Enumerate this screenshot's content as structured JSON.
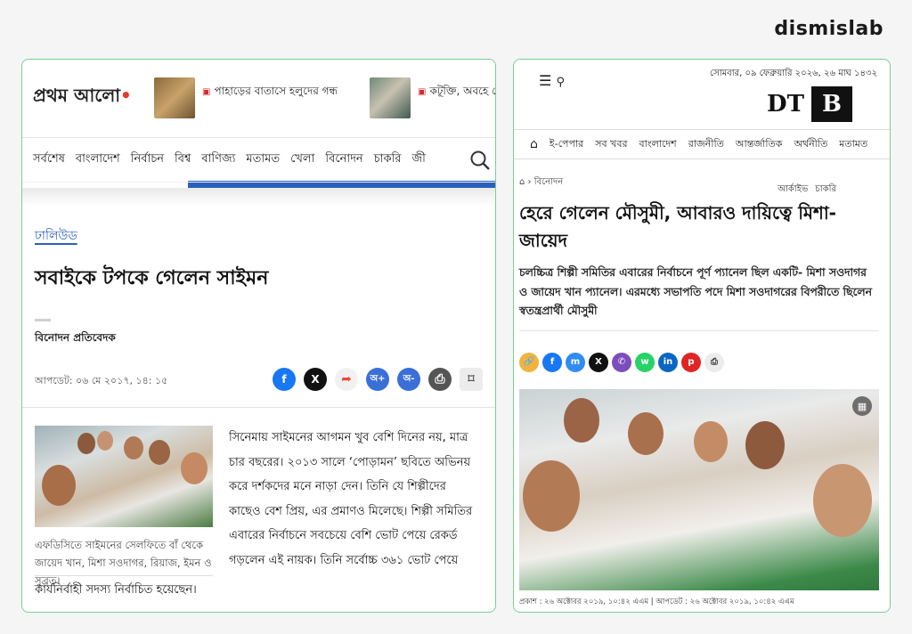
{
  "brand": "dismislab",
  "left": {
    "logo": "প্রথম আলো",
    "headlines": [
      "পাহাড়ের বাতাসে হলুদের গন্ধ",
      "কটূক্তি, অবহে পেরিয়ে যেভাবে সম"
    ],
    "nav": [
      "সর্বশেষ",
      "বাংলাদেশ",
      "নির্বাচন",
      "বিশ্ব",
      "বাণিজ্য",
      "মতামত",
      "খেলা",
      "বিনোদন",
      "চাকরি",
      "জী"
    ],
    "category": "ঢালিউড",
    "title": "সবাইকে টপকে গেলেন সাইমন",
    "author": "বিনোদন প্রতিবেদক",
    "date": "আপডেট: ০৬ মে ২০১৭, ১৪: ১৫",
    "caption": "এফডিসিতে সাইমনের সেলফিতে বাঁ থেকে জায়েদ খান, মিশা সওদাগর, রিয়াজ, ইমন ও সুব্রত।",
    "body": "সিনেমায় সাইমনের আগমন খুব বেশি দিনের নয়, মাত্র চার বছরের। ২০১৩ সালে ‘পোড়ামন’ ছবিতে অভিনয় করে দর্শকদের মনে নাড়া দেন। তিনি যে শিল্পীদের কাছেও বেশ প্রিয়, এর প্রমাণও মিলেছে। শিল্পী সমিতির এবারের নির্বাচনে সবচেয়ে বেশি ভোট পেয়ে রেকর্ড গড়লেন এই নায়ক। তিনি সর্বোচ্চ ৩৬১ ভোট পেয়ে",
    "last_line": "কার্যনির্বাহী সদস্য নির্বাচিত হয়েছেন।",
    "share_icons": [
      "facebook-icon",
      "x-icon",
      "share-icon",
      "font-increase-icon",
      "font-decrease-icon",
      "print-icon",
      "bookmark-icon"
    ],
    "share_labels": [
      "f",
      "X",
      "➦",
      "অ+",
      "অ-",
      "⎙",
      "⌑"
    ]
  },
  "right": {
    "date": "সোমবার, ০৯ ফেব্রুয়ারি ২০২৬, ২৬ মাঘ ১৪৩২",
    "logo_left": "DT",
    "logo_right": "B",
    "nav": [
      "ই-পেপার",
      "সব খবর",
      "বাংলাদেশ",
      "রাজনীতি",
      "আন্তর্জাতিক",
      "অর্থনীতি",
      "মতামত"
    ],
    "breadcrumb": "বিনোদন",
    "sub_links": [
      "আর্কাইভ",
      "চাকরি"
    ],
    "title": "হেরে গেলেন মৌসুমী, আবারও দায়িত্বে মিশা-জায়েদ",
    "lead": "চলচ্চিত্র শিল্পী সমিতির এবারের নির্বাচনে পূর্ণ প্যানেল ছিল একটি- মিশা সওদাগর ও জায়েদ খান প্যানেল। এরমধ্যে সভাপতি পদে মিশা সওদাগরের বিপরীতে ছিলেন স্বতন্ত্রপ্রার্থী মৌসুমী",
    "share_labels": [
      "🔗",
      "f",
      "m",
      "X",
      "✆",
      "w",
      "in",
      "p",
      "⎙"
    ],
    "footer": "প্রকাশ : ২৬ অক্টোবর ২০১৯, ১০:৪২ এএম  |  আপডেট : ২৬ অক্টোবর ২০১৯, ১০:৪২ এএম"
  },
  "colors": {
    "panel_border": "#7ccf94",
    "accent_blue": "#2b5fbd",
    "facebook": "#1877f2",
    "x": "#111111",
    "share_red": "#e74c3c"
  }
}
